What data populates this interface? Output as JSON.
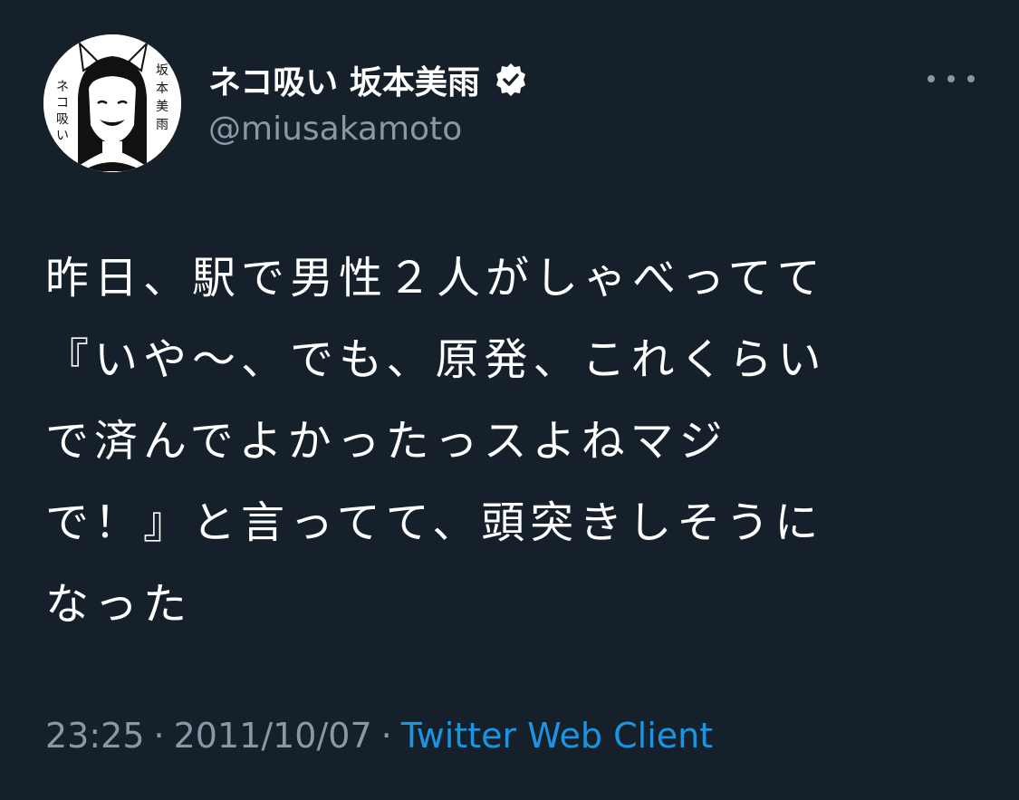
{
  "tweet": {
    "author": {
      "display_name": "ネコ吸い 坂本美雨",
      "handle": "@miusakamoto",
      "verified": true,
      "avatar_icon": "avatar-illustration"
    },
    "more_icon": "more-horizontal-icon",
    "text_lines": [
      "昨日、駅で男性２人がしゃべってて",
      "『いや〜、でも、原発、これくらい",
      "で済んでよかったっスよねマジ",
      "で！』と言ってて、頭突きしそうに",
      "なった"
    ],
    "time": "23:25",
    "date": "2011/10/07",
    "separator": "·",
    "source": "Twitter Web Client"
  },
  "colors": {
    "background": "#15202b",
    "primary_text": "#ffffff",
    "secondary_text": "#8899a6",
    "link": "#1b95e0"
  }
}
